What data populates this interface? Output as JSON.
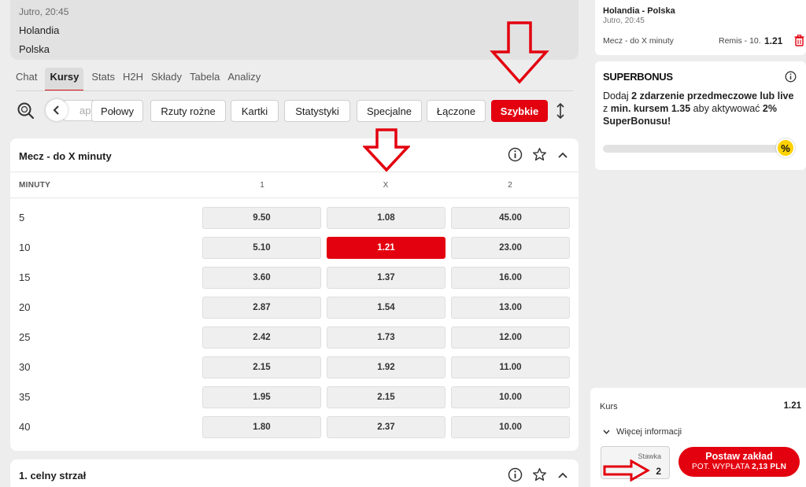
{
  "match": {
    "time": "Jutro, 20:45",
    "home": "Holandia",
    "away": "Polska"
  },
  "tabs": [
    {
      "label": "Chat",
      "active": false
    },
    {
      "label": "Kursy",
      "active": true
    },
    {
      "label": "Stats",
      "active": false
    },
    {
      "label": "H2H",
      "active": false
    },
    {
      "label": "Składy",
      "active": false
    },
    {
      "label": "Tabela",
      "active": false
    },
    {
      "label": "Analizy",
      "active": false
    }
  ],
  "filters": {
    "partial": "ap",
    "chips": [
      {
        "label": "Połowy",
        "active": false
      },
      {
        "label": "Rzuty rożne",
        "active": false
      },
      {
        "label": "Kartki",
        "active": false
      },
      {
        "label": "Statystyki",
        "active": false
      },
      {
        "label": "Specjalne",
        "active": false
      },
      {
        "label": "Łączone",
        "active": false
      },
      {
        "label": "Szybkie",
        "active": true
      }
    ]
  },
  "market": {
    "title": "Mecz - do X minuty",
    "headers": {
      "minute": "MINUTY",
      "c1": "1",
      "cx": "X",
      "c2": "2"
    },
    "rows": [
      {
        "minute": "5",
        "o1": "9.50",
        "ox": "1.08",
        "o2": "45.00"
      },
      {
        "minute": "10",
        "o1": "5.10",
        "ox": "1.21",
        "o2": "23.00"
      },
      {
        "minute": "15",
        "o1": "3.60",
        "ox": "1.37",
        "o2": "16.00"
      },
      {
        "minute": "20",
        "o1": "2.87",
        "ox": "1.54",
        "o2": "13.00"
      },
      {
        "minute": "25",
        "o1": "2.42",
        "ox": "1.73",
        "o2": "12.00"
      },
      {
        "minute": "30",
        "o1": "2.15",
        "ox": "1.92",
        "o2": "11.00"
      },
      {
        "minute": "35",
        "o1": "1.95",
        "ox": "2.15",
        "o2": "10.00"
      },
      {
        "minute": "40",
        "o1": "1.80",
        "ox": "2.37",
        "o2": "10.00"
      }
    ],
    "selected": {
      "minute": "10",
      "column": "X"
    }
  },
  "market2": {
    "title": "1. celny strzał"
  },
  "slip": {
    "match": "Holandia - Polska",
    "time": "Jutro, 20:45",
    "market": "Mecz - do X minuty",
    "pick": "Remis - 10.",
    "odd": "1.21"
  },
  "superbonus": {
    "title": "SUPERBONUS",
    "text_1": "Dodaj ",
    "text_2": "2 zdarzenie przedmeczowe lub live",
    "text_3": " z ",
    "text_4": "min. kursem 1.35",
    "text_5": " aby aktywować ",
    "text_6": "2% SuperBonusu!",
    "badge": "%",
    "progress": 0
  },
  "summary": {
    "kurs_label": "Kurs",
    "kurs_value": "1.21",
    "more_info": "Więcej informacji",
    "stake_label": "Stawka",
    "stake_value": "2",
    "place_bet": "Postaw zakład",
    "payout_label": "POT. WYPŁATA",
    "payout_value": "2,13 PLN"
  },
  "colors": {
    "accent": "#e3000f",
    "badge": "#ffd200"
  }
}
